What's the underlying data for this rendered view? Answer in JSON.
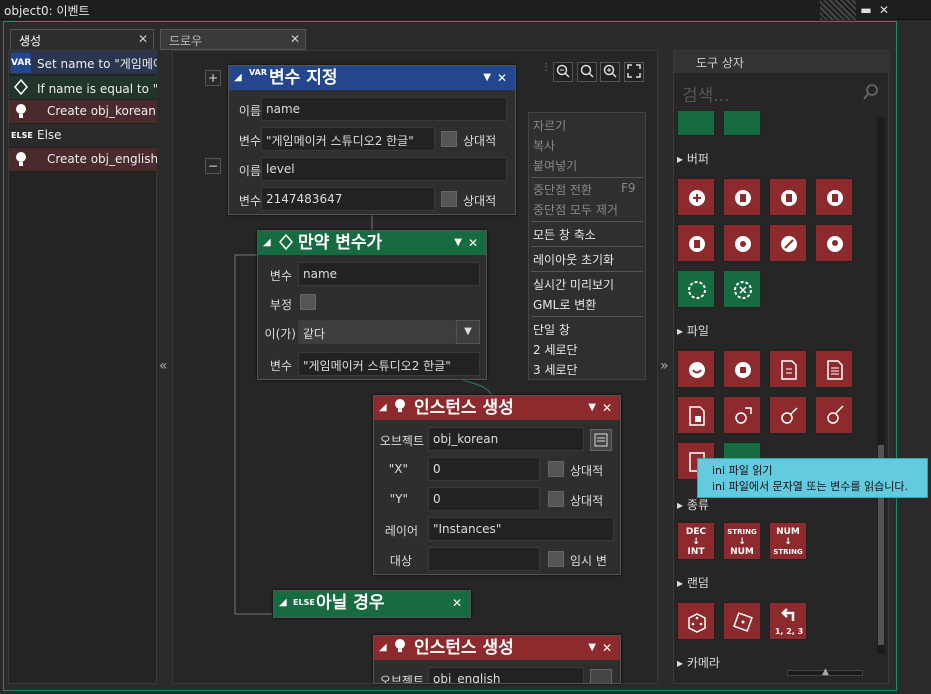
{
  "window": {
    "title": "object0: 이벤트",
    "min": "▬",
    "close": "✕"
  },
  "tabs": [
    {
      "label": "생성",
      "close": "✕"
    },
    {
      "label": "드로우",
      "close": "✕"
    }
  ],
  "event_list": [
    {
      "icon": "VAR",
      "text": "Set name to \"게임메이"
    },
    {
      "icon": "IF",
      "text": "If name is equal to \"게"
    },
    {
      "icon": "BULB",
      "text": "Create obj_korean a"
    },
    {
      "icon": "ELSE",
      "text": "Else"
    },
    {
      "icon": "BULB",
      "text": "Create obj_english a"
    }
  ],
  "nodes": {
    "set_var": {
      "title": "변수 지정",
      "icon": "VAR",
      "close": "✕",
      "rows": [
        {
          "label": "이름",
          "value": "name"
        },
        {
          "label": "변수",
          "value": "\"게임메이커 스튜디오2 한글\"",
          "check_label": "상대적"
        },
        {
          "label": "이름",
          "value": "level"
        },
        {
          "label": "변수",
          "value": "2147483647",
          "check_label": "상대적"
        }
      ]
    },
    "if_var": {
      "title": "만약 변수가",
      "close": "✕",
      "rows": {
        "var_label": "변수",
        "var_value": "name",
        "not_label": "부정",
        "op_label": "이(가)",
        "op_value": "같다",
        "val_label": "변수",
        "val_value": "\"게임메이커 스튜디오2 한글\""
      }
    },
    "create1": {
      "title": "인스턴스 생성",
      "close": "✕",
      "rows": {
        "obj_label": "오브젝트",
        "obj_value": "obj_korean",
        "x_label": "\"X\"",
        "x_value": "0",
        "y_label": "\"Y\"",
        "y_value": "0",
        "rel_label": "상대적",
        "layer_label": "레이어",
        "layer_value": "\"Instances\"",
        "target_label": "대상",
        "target_value": "",
        "temp_label": "임시 변"
      }
    },
    "else": {
      "title": "아닐 경우",
      "icon": "ELSE",
      "close": "✕"
    },
    "create2": {
      "title": "인스턴스 생성",
      "close": "✕",
      "obj_label": "오브젝트",
      "obj_value": "obj_english"
    }
  },
  "plus": "+",
  "minus": "−",
  "collapse_left": "«",
  "collapse_right": "»",
  "context_menu": [
    {
      "label": "자르기",
      "disabled": true
    },
    {
      "label": "복사",
      "disabled": true
    },
    {
      "label": "붙여넣기",
      "disabled": true
    },
    {
      "label": "중단점 전환",
      "shortcut": "F9",
      "disabled": true
    },
    {
      "label": "중단점 모두 제거",
      "disabled": true
    },
    {
      "label": "모든 창 축소",
      "disabled": false
    },
    {
      "label": "레이아웃 초기화",
      "disabled": false
    },
    {
      "label": "실시간 미리보기",
      "disabled": false
    },
    {
      "label": "GML로 변환",
      "disabled": false
    },
    {
      "label": "단일 창",
      "disabled": false
    },
    {
      "label": "2 세로단",
      "disabled": false
    },
    {
      "label": "3 세로단",
      "disabled": false
    }
  ],
  "toolbox": {
    "title": "도구 상자",
    "search_placeholder": "검색...",
    "sections": [
      "버퍼",
      "파일",
      "종류",
      "랜덤",
      "카메라"
    ],
    "conv_buttons": [
      {
        "top": "DEC",
        "bottom": "INT"
      },
      {
        "top": "STRING",
        "bottom": "NUM"
      },
      {
        "top": "NUM",
        "bottom": "STRING"
      }
    ],
    "rand_label": "1, 2, 3"
  },
  "tooltip": {
    "line1": "ini 파일 읽기",
    "line2": "ini 파일에서 문자열 또는 변수를 읽습니다."
  },
  "colors": {
    "accent": "#1d8a6a",
    "action_red": "#8c2a2e",
    "control_green": "#166b41",
    "var_blue": "#23468c",
    "tooltip": "#63cbe0"
  }
}
